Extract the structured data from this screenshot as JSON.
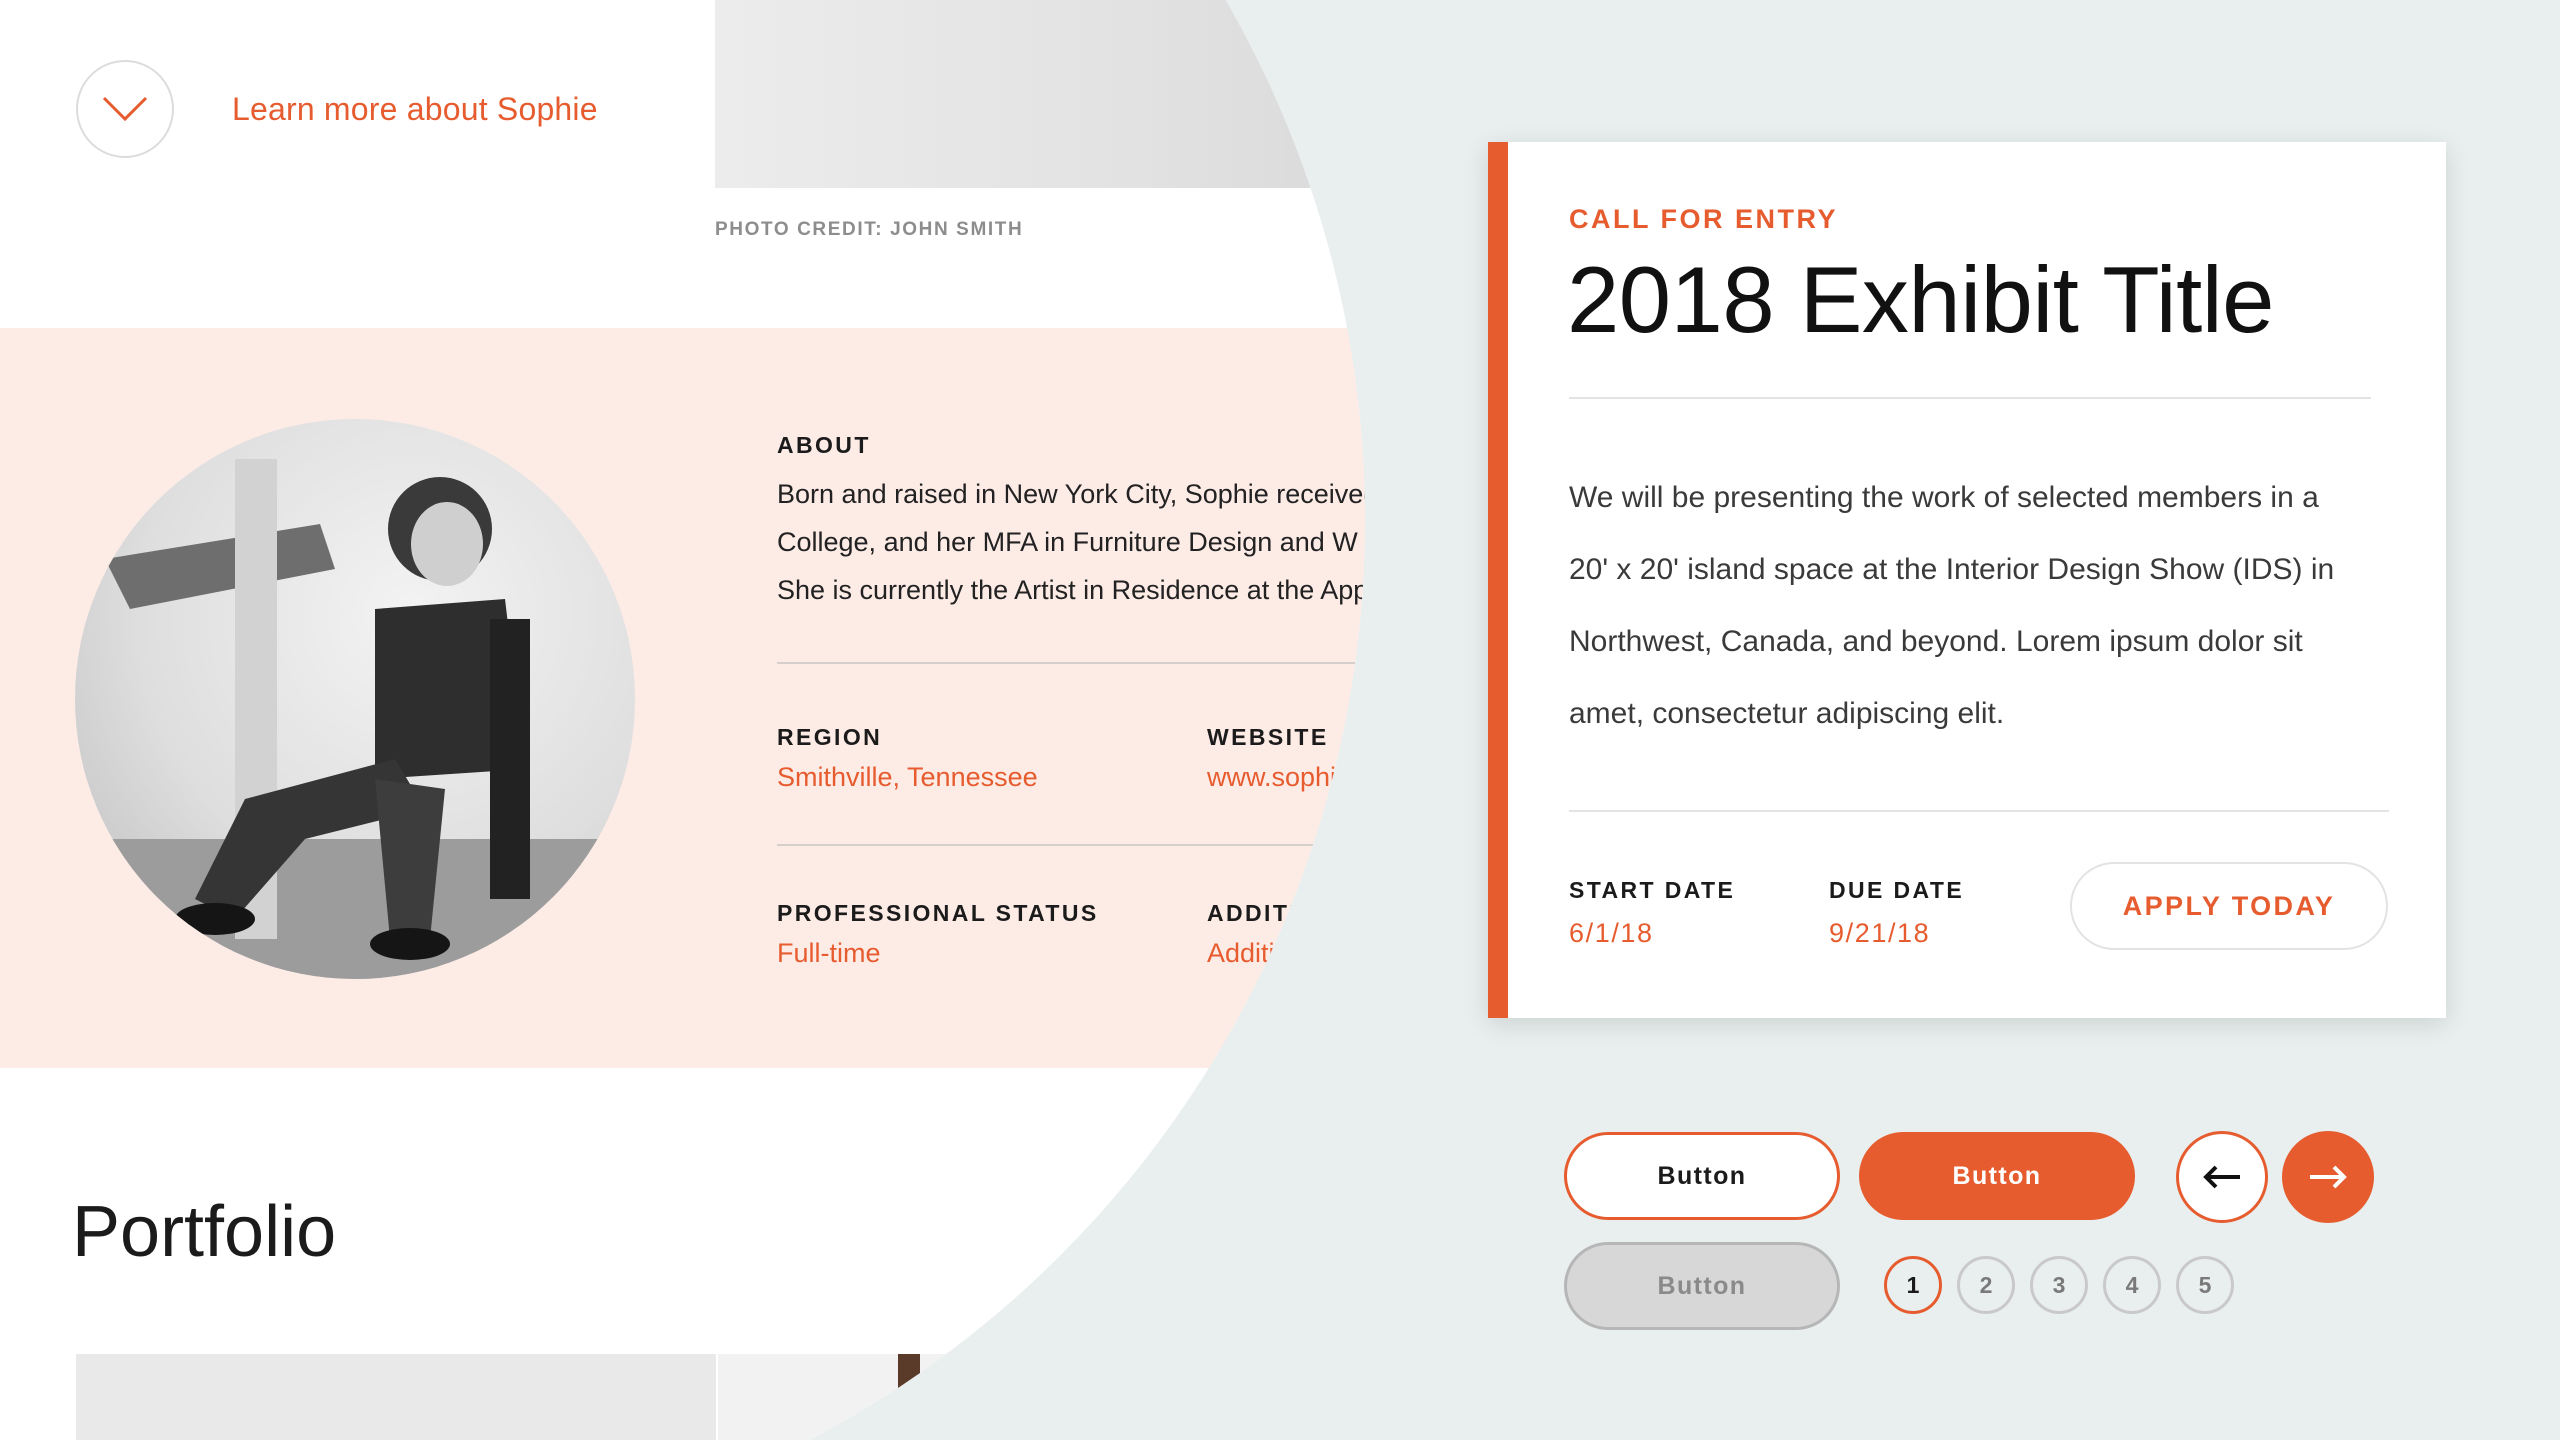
{
  "profile": {
    "learn_more": "Learn more about Sophie",
    "photo_credit": "PHOTO CREDIT: JOHN SMITH",
    "about": {
      "label": "ABOUT",
      "lines": [
        "Born and raised in New York City, Sophie received",
        "College, and her MFA in Furniture Design and W",
        "She is currently the Artist in Residence at the App"
      ]
    },
    "region": {
      "label": "REGION",
      "value": "Smithville, Tennessee"
    },
    "website": {
      "label": "WEBSITE",
      "value": "www.sophieg"
    },
    "professional_status": {
      "label": "PROFESSIONAL STATUS",
      "value": "Full-time"
    },
    "additional": {
      "label": "ADDITIONA",
      "value": "Additional F"
    },
    "portfolio_title": "Portfolio"
  },
  "card": {
    "eyebrow": "CALL FOR ENTRY",
    "title": "2018 Exhibit Title",
    "body_lines": [
      "We will be presenting the work of selected members in a",
      "20' x 20' island space at the Interior Design Show (IDS) in",
      "Northwest, Canada, and beyond. Lorem ipsum dolor sit",
      "amet, consectetur adipiscing elit."
    ],
    "start_date": {
      "label": "START DATE",
      "value": "6/1/18"
    },
    "due_date": {
      "label": "DUE DATE",
      "value": "9/21/18"
    },
    "apply_label": "APPLY TODAY"
  },
  "buttons": {
    "outline": "Button",
    "filled": "Button",
    "disabled": "Button"
  },
  "pagination": {
    "pages": [
      "1",
      "2",
      "3",
      "4",
      "5"
    ],
    "current": "1"
  },
  "colors": {
    "accent": "#e65c2f",
    "band": "#fdebe6",
    "background": "#e8efee"
  }
}
